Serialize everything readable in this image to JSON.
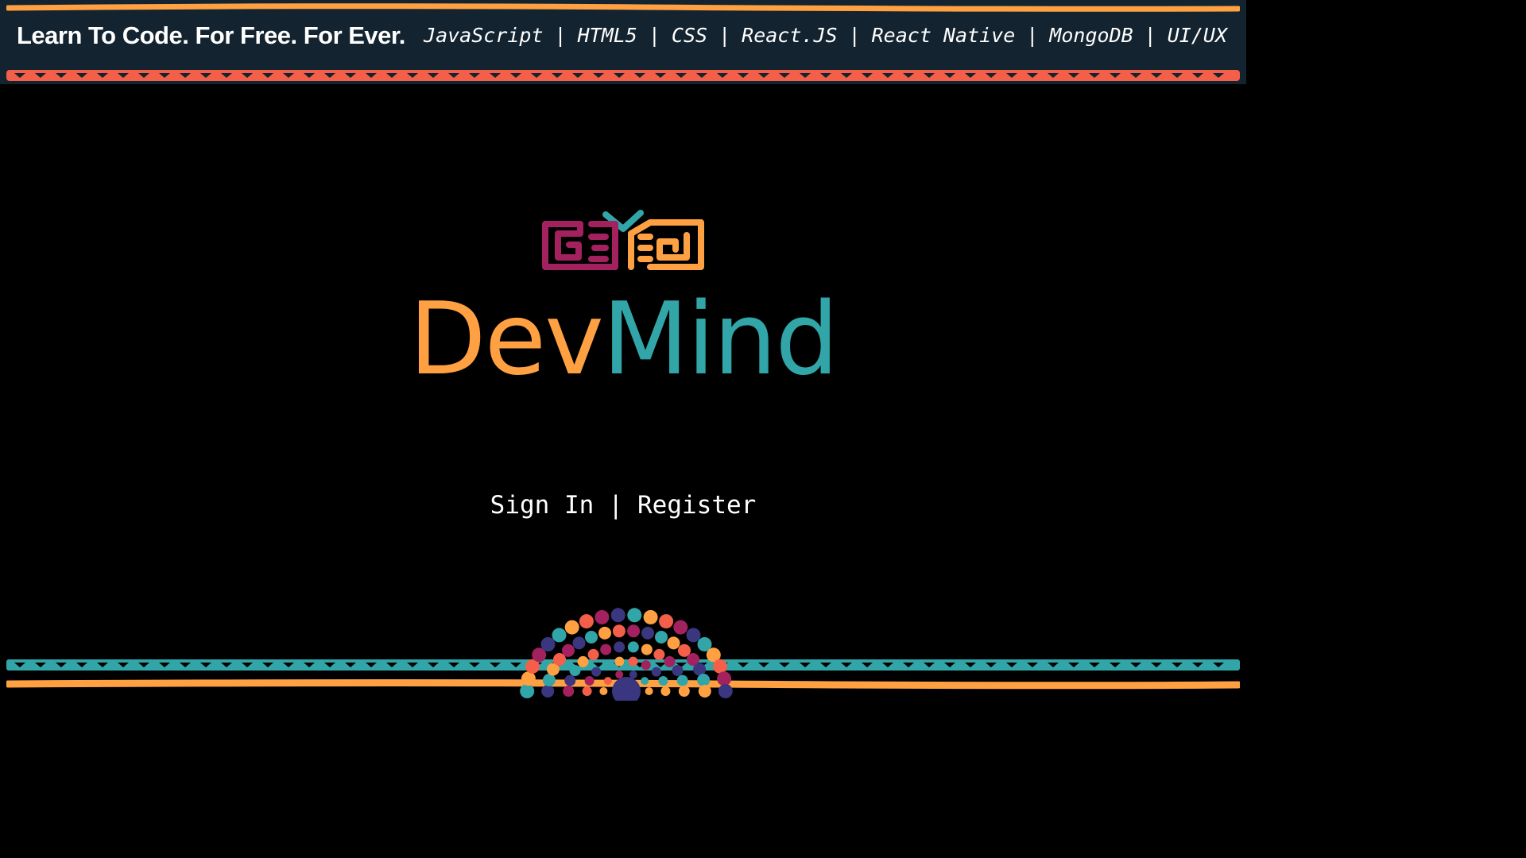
{
  "header": {
    "tagline": "Learn To Code. For Free. For Ever.",
    "topics": [
      {
        "label": "JavaScript"
      },
      {
        "label": "HTML5"
      },
      {
        "label": "CSS"
      },
      {
        "label": "React.JS"
      },
      {
        "label": "React Native"
      },
      {
        "label": "MongoDB"
      },
      {
        "label": "UI/UX"
      }
    ],
    "separator": "|"
  },
  "brand": {
    "part1": "Dev",
    "part2": "Mind",
    "logo_icon": "devmind-logo-icon"
  },
  "auth": {
    "sign_in": "Sign In",
    "separator": "|",
    "register": "Register"
  },
  "colors": {
    "background": "#000000",
    "header_bg": "#13232f",
    "orange": "#ffa142",
    "teal": "#31a5a8",
    "coral": "#f35f48",
    "magenta": "#a2215e",
    "indigo": "#3a3680"
  }
}
